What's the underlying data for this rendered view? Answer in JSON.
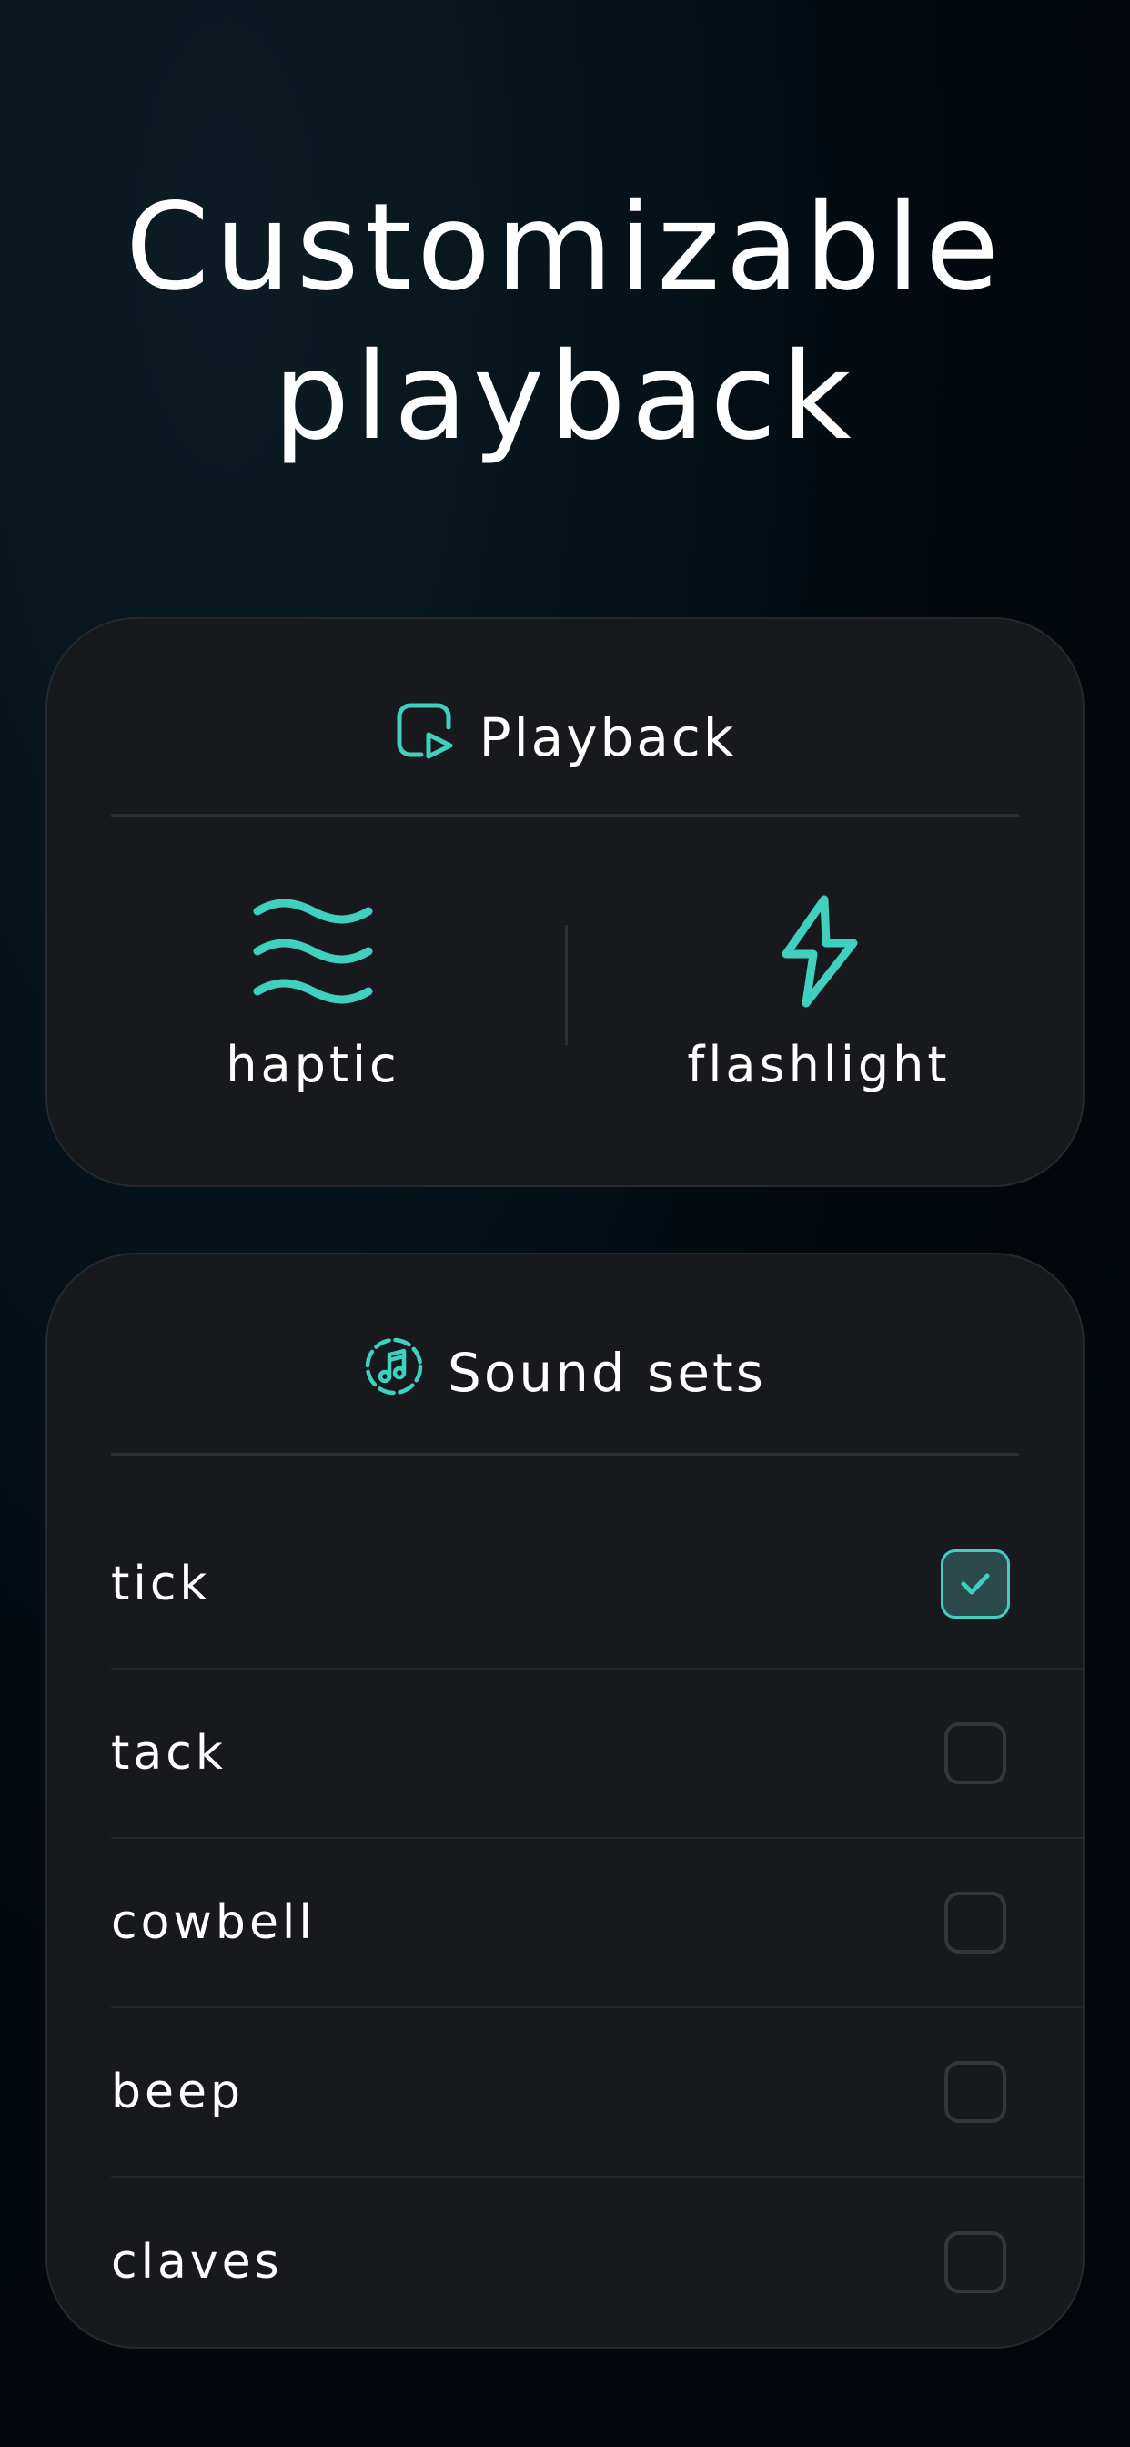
{
  "headline": {
    "line1": "Customizable",
    "line2": "playback"
  },
  "accent_color": "#3fd0c0",
  "playback_card": {
    "title": "Playback",
    "icon": "playback-icon",
    "modes": [
      {
        "label": "haptic",
        "icon": "waves-icon"
      },
      {
        "label": "flashlight",
        "icon": "bolt-icon"
      }
    ]
  },
  "sound_card": {
    "title": "Sound sets",
    "icon": "music-note-icon",
    "items": [
      {
        "label": "tick",
        "checked": true
      },
      {
        "label": "tack",
        "checked": false
      },
      {
        "label": "cowbell",
        "checked": false
      },
      {
        "label": "beep",
        "checked": false
      },
      {
        "label": "claves",
        "checked": false
      }
    ]
  }
}
